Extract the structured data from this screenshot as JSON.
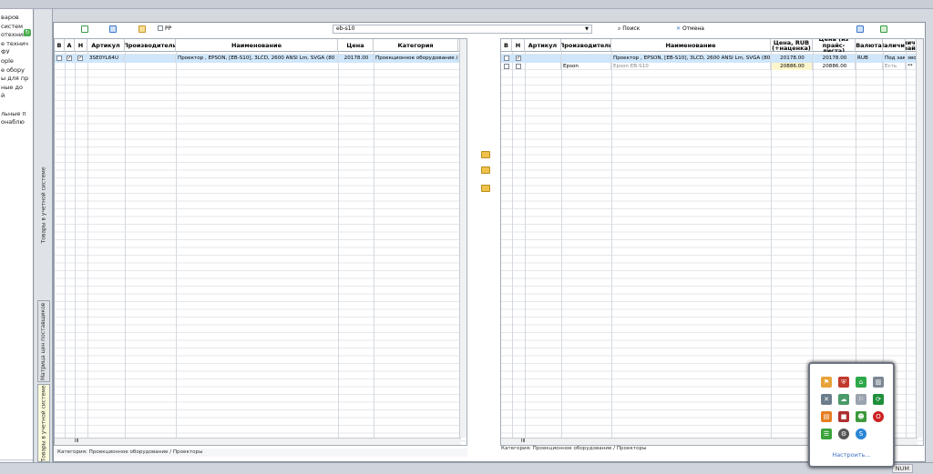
{
  "left_nav": {
    "items": [
      "варов",
      "систем",
      "отехник",
      "е технич",
      "ФУ",
      "ople",
      "е обору",
      "ы для пр",
      "ные до",
      "й",
      "",
      "льные п",
      "онаблю"
    ],
    "bottom_left": "‹",
    "bottom_right": "›"
  },
  "vertical_tabs": {
    "top": "Товары в учетной системе",
    "middle": "Матрица цен поставщиков",
    "bottom": "Товары в учетной системе",
    "splitter": "......"
  },
  "toolbar": {
    "pp_label": "PP",
    "search_value": "eb-s10",
    "search_button": "Поиск",
    "cancel_button": "Отмена"
  },
  "left_grid": {
    "columns": [
      "В",
      "А",
      "Н",
      "Артикул",
      "Производитель",
      "Наименование",
      "Цена",
      "Категория"
    ],
    "rows": [
      {
        "v": "",
        "a": "✓",
        "n": "✓",
        "article": "3SE0YL64U",
        "maker": "",
        "name": "Проектор , EPSON, [EB-S10], 3LCD, 2600 ANSI Lm, SVGA (80",
        "price": "20178.00",
        "category": "Проекционное оборудование /"
      }
    ],
    "status": "Категория: Проекционное оборудование / Проекторы",
    "hscroll_label": "III"
  },
  "right_grid": {
    "columns": [
      "В",
      "Н",
      "Артикул",
      "Производитель",
      "Наименование",
      "Цена, RUB (+наценка)",
      "Цена (из прайс-листа)",
      "Валюта",
      "Наличие",
      "личи райс"
    ],
    "rows": [
      {
        "v": "",
        "n": "✓",
        "article": "",
        "maker": "",
        "name": "Проектор , EPSON, [EB-S10], 3LCD, 2600 ANSI Lm, SVGA (80",
        "price_rub": "20178.00",
        "price_list": "20178.00",
        "currency": "RUB",
        "avail": "Под зак",
        "avail2": "звон"
      },
      {
        "v": "",
        "n": "",
        "article": "",
        "maker": "Epson",
        "name": "Epson EB-S10",
        "price_rub": "20886.00",
        "price_list": "20886.00",
        "currency": "",
        "avail": "Есть",
        "avail2": "**"
      }
    ],
    "status": "Категория: Проекционное оборудование / Проекторы",
    "hscroll_label": "III"
  },
  "statusbar": {
    "num": "NUM"
  },
  "tray": {
    "configure": "Настроить..."
  },
  "colors": {
    "selection": "#cfe6fb",
    "tray_link": "#3a6fc4",
    "price_highlight": "#fdf6cc"
  }
}
